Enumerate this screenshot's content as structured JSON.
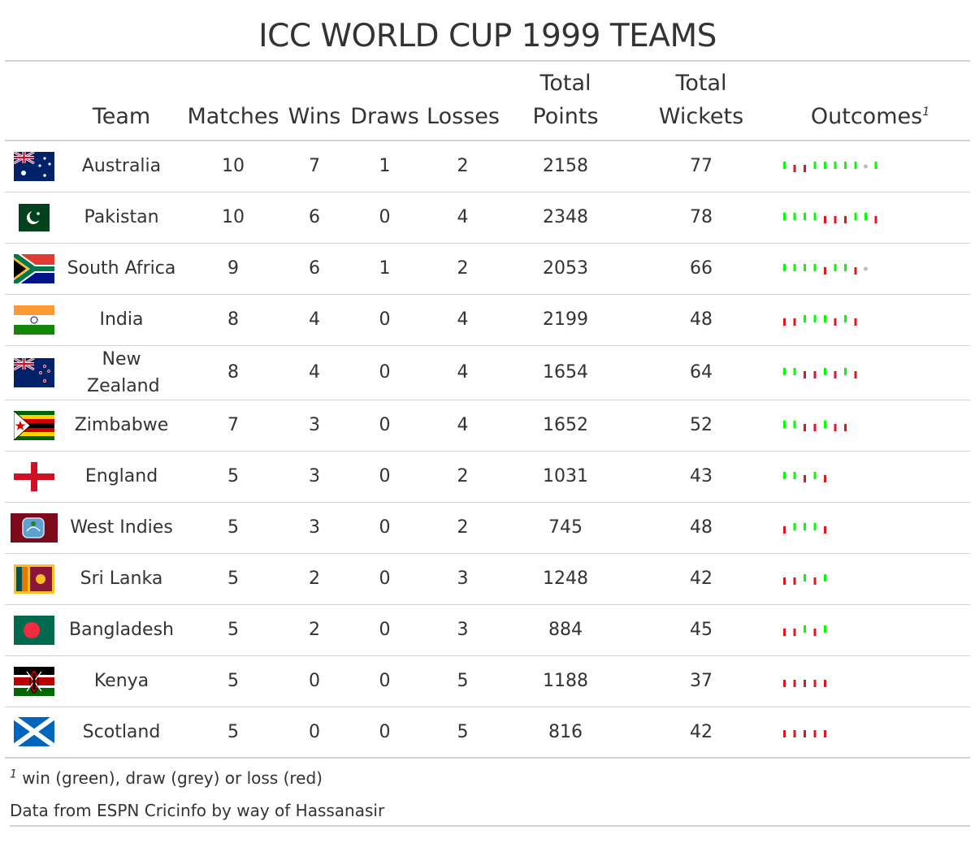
{
  "title": "ICC WORLD CUP 1999 TEAMS",
  "chart_data": {
    "type": "table",
    "columns": [
      "",
      "Team",
      "Matches",
      "Wins",
      "Draws",
      "Losses",
      "Total Points",
      "Total Wickets",
      "Outcomes"
    ],
    "header": {
      "team": "Team",
      "matches": "Matches",
      "wins": "Wins",
      "draws": "Draws",
      "losses": "Losses",
      "points_1": "Total",
      "points_2": "Points",
      "wickets_1": "Total",
      "wickets_2": "Wickets",
      "outcomes": "Outcomes",
      "outcomes_mark": "1"
    },
    "outcome_colors": {
      "W": "#00ff00",
      "D": "#bbbbbb",
      "L": "#e8141b"
    },
    "rows": [
      {
        "team": "Australia",
        "flag": "australia-flag",
        "matches": "10",
        "wins": "7",
        "draws": "1",
        "losses": "2",
        "points": "2158",
        "wickets": "77",
        "outcomes": [
          "W",
          "L",
          "L",
          "W",
          "W",
          "W",
          "W",
          "W",
          "D",
          "W"
        ]
      },
      {
        "team": "Pakistan",
        "flag": "pakistan-flag",
        "matches": "10",
        "wins": "6",
        "draws": "0",
        "losses": "4",
        "points": "2348",
        "wickets": "78",
        "outcomes": [
          "W",
          "W",
          "W",
          "W",
          "L",
          "L",
          "L",
          "W",
          "W",
          "L"
        ]
      },
      {
        "team": "South Africa",
        "flag": "south-africa-flag",
        "matches": "9",
        "wins": "6",
        "draws": "1",
        "losses": "2",
        "points": "2053",
        "wickets": "66",
        "outcomes": [
          "W",
          "W",
          "W",
          "W",
          "L",
          "W",
          "W",
          "L",
          "D"
        ]
      },
      {
        "team": "India",
        "flag": "india-flag",
        "matches": "8",
        "wins": "4",
        "draws": "0",
        "losses": "4",
        "points": "2199",
        "wickets": "48",
        "outcomes": [
          "L",
          "L",
          "W",
          "W",
          "W",
          "L",
          "W",
          "L"
        ]
      },
      {
        "team": "New Zealand",
        "flag": "new-zealand-flag",
        "matches": "8",
        "wins": "4",
        "draws": "0",
        "losses": "4",
        "points": "1654",
        "wickets": "64",
        "outcomes": [
          "W",
          "W",
          "L",
          "L",
          "W",
          "L",
          "W",
          "L"
        ]
      },
      {
        "team": "Zimbabwe",
        "flag": "zimbabwe-flag",
        "matches": "7",
        "wins": "3",
        "draws": "0",
        "losses": "4",
        "points": "1652",
        "wickets": "52",
        "outcomes": [
          "W",
          "W",
          "L",
          "L",
          "W",
          "L",
          "L"
        ]
      },
      {
        "team": "England",
        "flag": "england-flag",
        "matches": "5",
        "wins": "3",
        "draws": "0",
        "losses": "2",
        "points": "1031",
        "wickets": "43",
        "outcomes": [
          "W",
          "W",
          "L",
          "W",
          "L"
        ]
      },
      {
        "team": "West Indies",
        "flag": "west-indies-flag",
        "matches": "5",
        "wins": "3",
        "draws": "0",
        "losses": "2",
        "points": "745",
        "wickets": "48",
        "outcomes": [
          "L",
          "W",
          "W",
          "W",
          "L"
        ]
      },
      {
        "team": "Sri Lanka",
        "flag": "sri-lanka-flag",
        "matches": "5",
        "wins": "2",
        "draws": "0",
        "losses": "3",
        "points": "1248",
        "wickets": "42",
        "outcomes": [
          "L",
          "L",
          "W",
          "L",
          "W"
        ]
      },
      {
        "team": "Bangladesh",
        "flag": "bangladesh-flag",
        "matches": "5",
        "wins": "2",
        "draws": "0",
        "losses": "3",
        "points": "884",
        "wickets": "45",
        "outcomes": [
          "L",
          "L",
          "W",
          "L",
          "W"
        ]
      },
      {
        "team": "Kenya",
        "flag": "kenya-flag",
        "matches": "5",
        "wins": "0",
        "draws": "0",
        "losses": "5",
        "points": "1188",
        "wickets": "37",
        "outcomes": [
          "L",
          "L",
          "L",
          "L",
          "L"
        ]
      },
      {
        "team": "Scotland",
        "flag": "scotland-flag",
        "matches": "5",
        "wins": "0",
        "draws": "0",
        "losses": "5",
        "points": "816",
        "wickets": "42",
        "outcomes": [
          "L",
          "L",
          "L",
          "L",
          "L"
        ]
      }
    ]
  },
  "footnote": {
    "mark": "1",
    "text": "win (green), draw (grey) or loss (red)"
  },
  "source": "Data from ESPN Cricinfo by way of Hassanasir"
}
